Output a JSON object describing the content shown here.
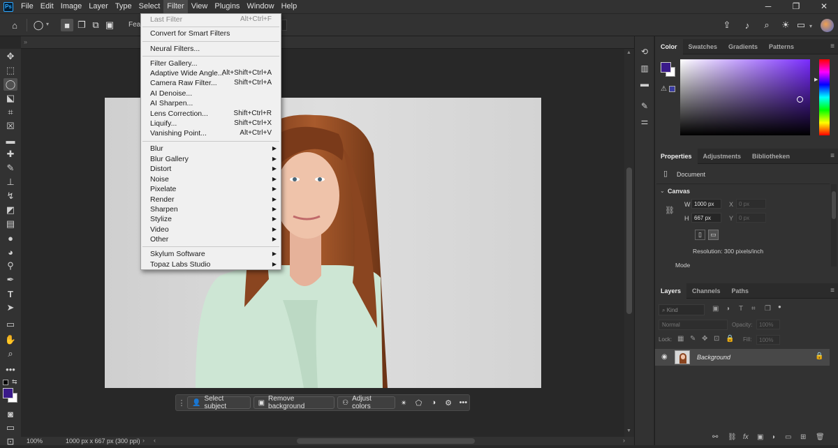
{
  "menubar": {
    "logo": "Ps",
    "items": [
      "File",
      "Edit",
      "Image",
      "Layer",
      "Type",
      "Select",
      "Filter",
      "View",
      "Plugins",
      "Window",
      "Help"
    ],
    "active": "Filter",
    "controls": {
      "minimize": "─",
      "restore": "❐",
      "close": "✕"
    }
  },
  "options_bar": {
    "feather_label_partial": "Feat"
  },
  "filter_menu": {
    "items": [
      {
        "label": "Last Filter",
        "shortcut": "Alt+Ctrl+F",
        "disabled": true
      },
      {
        "label": "Convert for Smart Filters",
        "shortcut": ""
      },
      {
        "label": "Neural Filters...",
        "shortcut": ""
      },
      {
        "label": "Filter Gallery...",
        "shortcut": ""
      },
      {
        "label": "Adaptive Wide Angle...",
        "shortcut": "Alt+Shift+Ctrl+A"
      },
      {
        "label": "Camera Raw Filter...",
        "shortcut": "Shift+Ctrl+A"
      },
      {
        "label": "AI Denoise...",
        "shortcut": ""
      },
      {
        "label": "AI Sharpen...",
        "shortcut": ""
      },
      {
        "label": "Lens Correction...",
        "shortcut": "Shift+Ctrl+R"
      },
      {
        "label": "Liquify...",
        "shortcut": "Shift+Ctrl+X"
      },
      {
        "label": "Vanishing Point...",
        "shortcut": "Alt+Ctrl+V"
      },
      {
        "label": "Blur",
        "submenu": true
      },
      {
        "label": "Blur Gallery",
        "submenu": true
      },
      {
        "label": "Distort",
        "submenu": true
      },
      {
        "label": "Noise",
        "submenu": true
      },
      {
        "label": "Pixelate",
        "submenu": true
      },
      {
        "label": "Render",
        "submenu": true
      },
      {
        "label": "Sharpen",
        "submenu": true
      },
      {
        "label": "Stylize",
        "submenu": true
      },
      {
        "label": "Video",
        "submenu": true
      },
      {
        "label": "Other",
        "submenu": true
      },
      {
        "label": "Skylum Software",
        "submenu": true
      },
      {
        "label": "Topaz Labs Studio",
        "submenu": true
      }
    ]
  },
  "taskbar": {
    "select_subject": "Select subject",
    "remove_background": "Remove background",
    "adjust_colors": "Adjust colors",
    "more": "•••"
  },
  "status": {
    "zoom": "100%",
    "doc_info": "1000 px x 667 px (300 ppi)"
  },
  "color_panel": {
    "tabs": [
      "Color",
      "Swatches",
      "Gradients",
      "Patterns"
    ],
    "active_tab": "Color",
    "foreground": "#3a1a8a",
    "background": "#ffffff",
    "hue": "#7a2cff"
  },
  "properties_panel": {
    "tabs": [
      "Properties",
      "Adjustments",
      "Bibliotheken"
    ],
    "active_tab": "Properties",
    "doc_label": "Document",
    "section": "Canvas",
    "w_label": "W",
    "w_value": "1000 px",
    "h_label": "H",
    "h_value": "667 px",
    "x_label": "X",
    "x_value": "0 px",
    "y_label": "Y",
    "y_value": "0 px",
    "resolution": "Resolution: 300 pixels/inch",
    "mode_label": "Mode"
  },
  "layers_panel": {
    "tabs": [
      "Layers",
      "Channels",
      "Paths"
    ],
    "active_tab": "Layers",
    "kind_placeholder": "Kind",
    "blend_mode": "Normal",
    "opacity_label": "Opacity:",
    "opacity_value": "100%",
    "lock_label": "Lock:",
    "fill_label": "Fill:",
    "fill_value": "100%",
    "layer_name": "Background"
  }
}
